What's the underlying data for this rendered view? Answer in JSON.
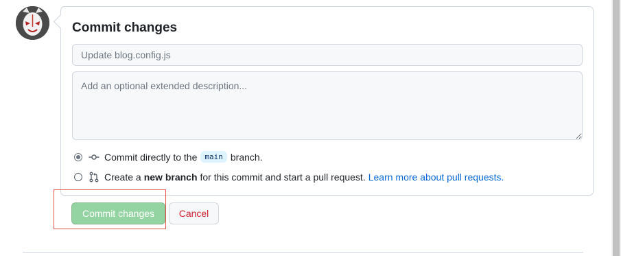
{
  "form": {
    "title": "Commit changes",
    "summary_placeholder": "Update blog.config.js",
    "summary_value": "",
    "description_placeholder": "Add an optional extended description...",
    "description_value": ""
  },
  "options": {
    "direct": {
      "selected": true,
      "icon": "git-commit-icon",
      "text_before": "Commit directly to the",
      "branch": "main",
      "text_after": "branch."
    },
    "new_branch": {
      "selected": false,
      "icon": "git-pull-request-icon",
      "text_before": "Create a",
      "bold": "new branch",
      "text_after": "for this commit and start a pull request.",
      "link": "Learn more about pull requests."
    }
  },
  "buttons": {
    "commit_label": "Commit changes",
    "cancel_label": "Cancel"
  },
  "colors": {
    "commit_button": "#94d3a2",
    "cancel_text": "#cf222e",
    "link": "#0969da",
    "highlight": "#e5534b"
  }
}
